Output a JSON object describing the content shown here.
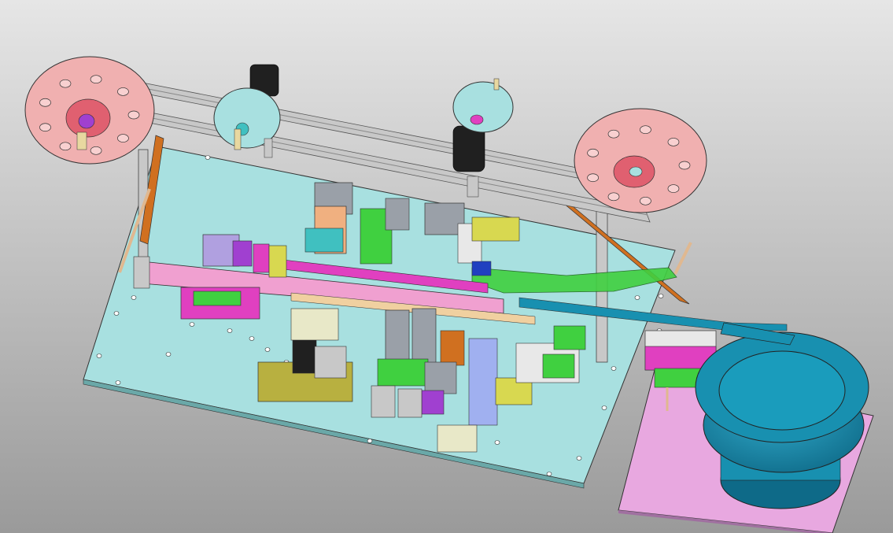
{
  "scene": {
    "description_visible_text": "",
    "background": {
      "top": "#e6e6e6",
      "bottom": "#9a9a9a"
    },
    "colors": {
      "base_plate": "#a8e0e0",
      "feeder_plate": "#e8a8e0",
      "reel": "#f0b0b0",
      "reel_hub": "#e06070",
      "bowl": "#1890b0",
      "bowl_dark": "#0e6a88",
      "rail": "#c8c8c8",
      "magenta": "#e040c0",
      "yellow": "#d8d850",
      "olive": "#b8b040",
      "green": "#40d040",
      "orange": "#d07020",
      "gray_cyl": "#9aa0a8",
      "black": "#202020",
      "pink": "#f0a0d0",
      "purple": "#a040d0"
    },
    "components": [
      "reel-left",
      "reel-right",
      "reel-center-left",
      "reel-center-right",
      "top-rail",
      "base-plate",
      "vibratory-bowl-feeder",
      "feeder-plate",
      "main-track",
      "green-chute",
      "actuator-cluster"
    ]
  }
}
